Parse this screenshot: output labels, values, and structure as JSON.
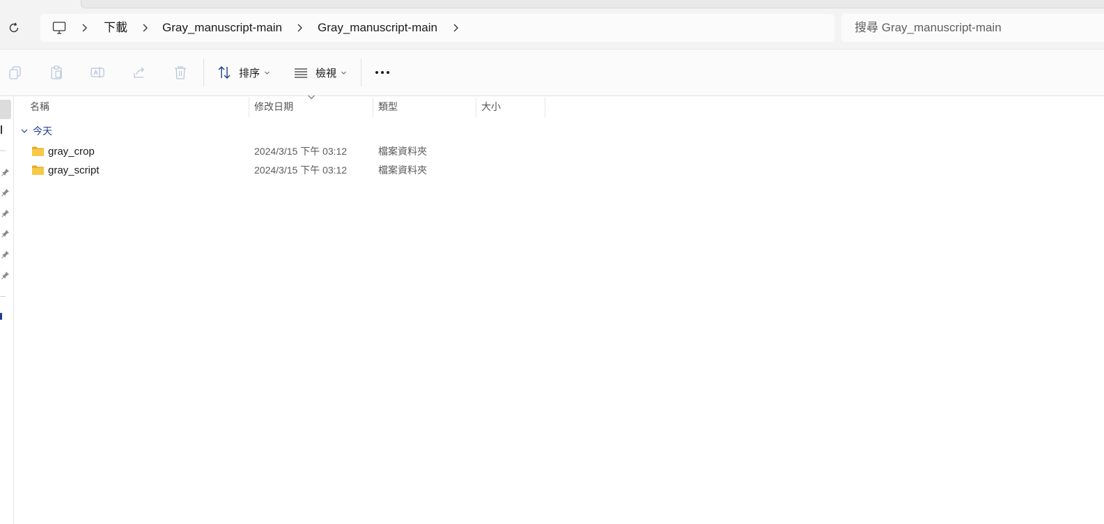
{
  "breadcrumb": {
    "items": [
      "下載",
      "Gray_manuscript-main",
      "Gray_manuscript-main"
    ]
  },
  "search": {
    "placeholder": "搜尋 Gray_manuscript-main"
  },
  "toolbar": {
    "sort_label": "排序",
    "view_label": "檢視",
    "more_label": "···"
  },
  "columns": {
    "name": "名稱",
    "modified": "修改日期",
    "type": "類型",
    "size": "大小"
  },
  "group": {
    "label": "今天"
  },
  "files": [
    {
      "name": "gray_crop",
      "modified": "2024/3/15 下午 03:12",
      "type": "檔案資料夾",
      "size": ""
    },
    {
      "name": "gray_script",
      "modified": "2024/3/15 下午 03:12",
      "type": "檔案資料夾",
      "size": ""
    }
  ],
  "colors": {
    "accent": "#1c3d8f",
    "folder": "#f3c44d",
    "icon_disabled": "#b6c6dc"
  }
}
